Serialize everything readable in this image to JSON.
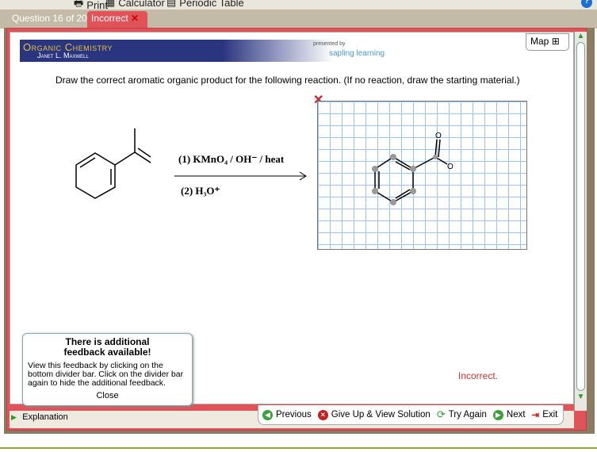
{
  "toolbar": {
    "print": "Print",
    "calculator": "Calculator",
    "periodic_table": "Periodic Table",
    "help": "?"
  },
  "tabs": {
    "question": "Question 16 of 20",
    "status": "Incorrect"
  },
  "banner": {
    "title": "Organic Chemistry",
    "author": "Janet L. Maxwell",
    "presented_by": "presented by",
    "brand": "sapling learning"
  },
  "map_label": "Map",
  "question": "Draw the correct aromatic organic product for the following reaction. (If no reaction, draw the starting material.)",
  "reaction": {
    "step1": "(1) KMnO₄ / OH⁻ / heat",
    "step2": "(2) H₃O⁺"
  },
  "feedback": {
    "title": "There is additional feedback available!",
    "body": "View this feedback by clicking on the bottom divider bar. Click on the divider bar again to hide the additional feedback.",
    "close": "Close"
  },
  "result": "Incorrect.",
  "explanation": "Explanation",
  "buttons": {
    "previous": "Previous",
    "give_up": "Give Up & View Solution",
    "try_again": "Try Again",
    "next": "Next",
    "exit": "Exit"
  },
  "colors": {
    "incorrect": "#e05358",
    "error_text": "#d03030"
  }
}
